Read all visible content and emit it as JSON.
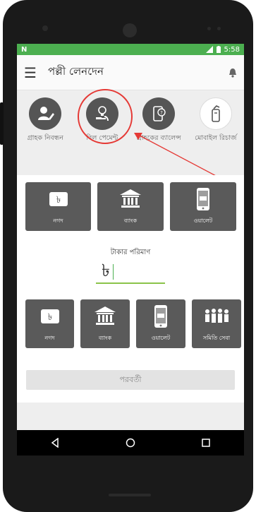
{
  "status_bar": {
    "left_icon": "N",
    "time": "5:58"
  },
  "app_bar": {
    "title": "পল্লী লেনদেন"
  },
  "services": [
    {
      "label": "গ্রাহক নিবন্ধন",
      "icon": "user-edit-icon"
    },
    {
      "label": "বিল পেমেন্ট",
      "icon": "bill-payment-icon"
    },
    {
      "label": "গ্রাহকের ব্যালেন্স",
      "icon": "balance-icon"
    },
    {
      "label": "মোবাইল রিচার্জ",
      "icon": "recharge-icon"
    }
  ],
  "pay_from": [
    {
      "label": "নগদ",
      "icon": "taka-icon"
    },
    {
      "label": "ব্যাংক",
      "icon": "bank-icon"
    },
    {
      "label": "ওয়ালেট",
      "icon": "wallet-icon"
    }
  ],
  "amount": {
    "label": "টাকার পরিমাণ",
    "symbol": "৳"
  },
  "pay_to": [
    {
      "label": "নগদ",
      "icon": "taka-icon"
    },
    {
      "label": "ব্যাংক",
      "icon": "bank-icon"
    },
    {
      "label": "ওয়ালেট",
      "icon": "wallet-icon"
    },
    {
      "label": "সমিতি সেবা",
      "icon": "group-icon"
    }
  ],
  "next_button": {
    "label": "পরবর্তী"
  },
  "colors": {
    "status_bar": "#4caf50",
    "tile": "#5a5a5a",
    "annotation": "#e53935",
    "underline": "#8bc34a"
  }
}
